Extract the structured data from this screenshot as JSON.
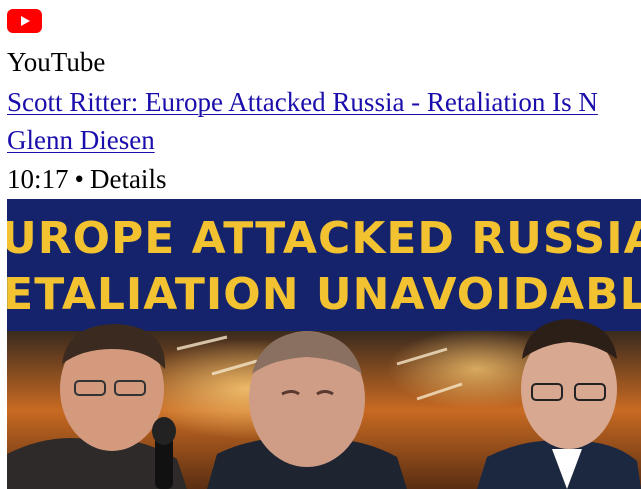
{
  "result": {
    "source_label": "YouTube",
    "video_title": "Scott Ritter: Europe Attacked Russia - Retaliation Is N",
    "channel_name": "Glenn Diesen",
    "duration": "10:17",
    "separator": "•",
    "details_label": "Details"
  },
  "thumbnail": {
    "headline_line1": "EUROPE ATTACKED RUSSIA:",
    "headline_line2": "RETALIATION UNAVOIDABLE"
  },
  "colors": {
    "youtube_red": "#ff0000",
    "link_blue": "#1a0dab",
    "thumb_banner": "#14236b",
    "headline_yellow": "#f2c230"
  },
  "icons": {
    "source_icon": "youtube-play-icon"
  }
}
